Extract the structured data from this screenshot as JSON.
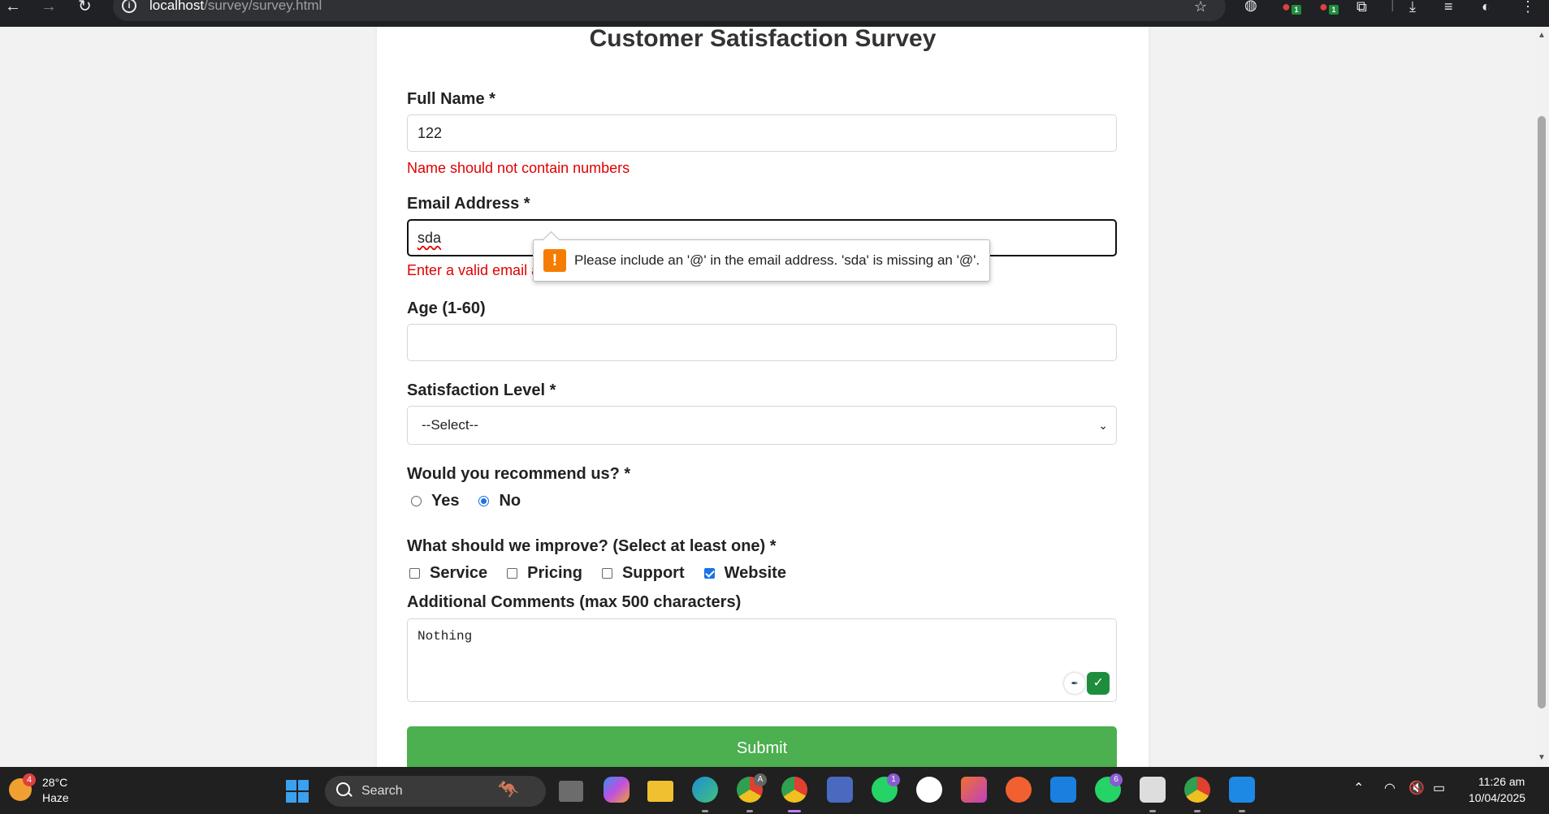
{
  "browser": {
    "url_host": "localhost",
    "url_path": "/survey/survey.html",
    "icons": [
      "back-icon",
      "forward-icon",
      "reload-icon",
      "site-info-icon",
      "bookmark-star-icon",
      "extensions-icon",
      "download-icon",
      "media-icon",
      "profile-icon",
      "menu-icon"
    ],
    "ext_badges": [
      "1",
      "1"
    ]
  },
  "form": {
    "title": "Customer Satisfaction Survey",
    "full_name": {
      "label": "Full Name *",
      "value": "122",
      "error": "Name should not contain numbers"
    },
    "email": {
      "label": "Email Address *",
      "value": "sda",
      "error": "Enter a valid email address"
    },
    "tooltip": {
      "text": "Please include an '@' in the email address. 'sda' is missing an '@'.",
      "icon": "!"
    },
    "age": {
      "label": "Age (1-60)",
      "value": ""
    },
    "satisfaction": {
      "label": "Satisfaction Level *",
      "selected": "--Select--"
    },
    "recommend": {
      "label": "Would you recommend us? *",
      "options": [
        "Yes",
        "No"
      ],
      "selected": "No"
    },
    "improve": {
      "label": "What should we improve? (Select at least one) *",
      "options": [
        "Service",
        "Pricing",
        "Support",
        "Website"
      ],
      "checked": [
        "Website"
      ]
    },
    "comments": {
      "label": "Additional Comments (max 500 characters)",
      "value": "Nothing"
    },
    "submit_label": "Submit"
  },
  "taskbar": {
    "weather": {
      "temp": "28°C",
      "condition": "Haze",
      "badge": "4"
    },
    "search_placeholder": "Search",
    "badges": {
      "chrome_profile": "A",
      "whatsapp1": "1",
      "whatsapp2": "6"
    },
    "clock": {
      "time": "11:26 am",
      "date": "10/04/2025"
    }
  }
}
